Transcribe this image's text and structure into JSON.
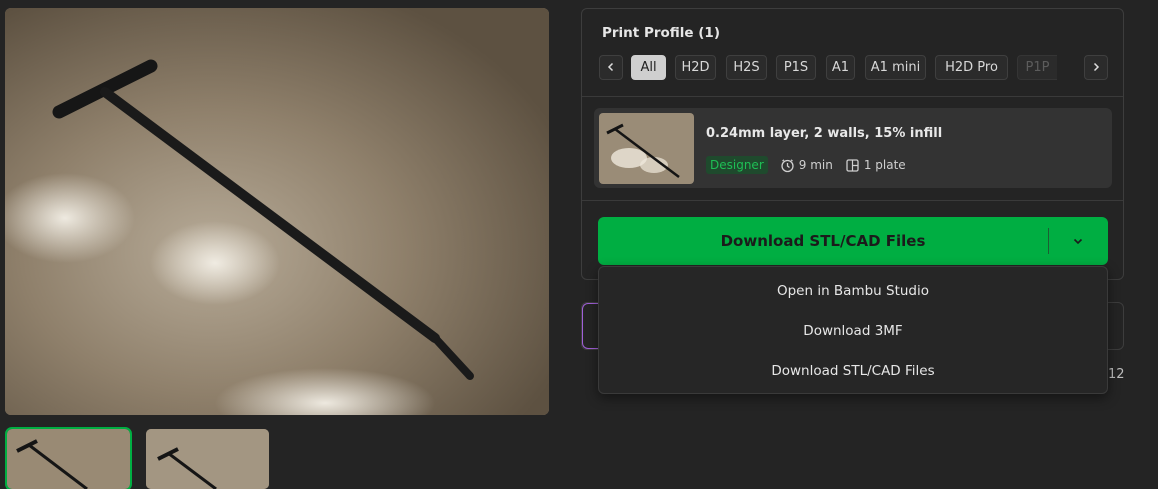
{
  "profile": {
    "title": "Print Profile (1)",
    "tabs": [
      "All",
      "H2D",
      "H2S",
      "P1S",
      "A1",
      "A1 mini",
      "H2D Pro",
      "P1P"
    ],
    "active_tab": "All",
    "card": {
      "name": "0.24mm layer, 2 walls, 15% infill",
      "badge": "Designer",
      "time": "9 min",
      "plates": "1 plate"
    }
  },
  "download": {
    "label": "Download STL/CAD Files",
    "menu": [
      "Open in Bambu Studio",
      "Download 3MF",
      "Download STL/CAD Files"
    ]
  },
  "partial_text": "12",
  "colors": {
    "accent": "#00ae42",
    "badge_text": "#1fbf55",
    "badge_bg": "#1f4a2d",
    "highlight_border": "#a060d8"
  },
  "icons": {
    "prev": "chevron-left-icon",
    "next": "chevron-right-icon",
    "time": "clock-icon",
    "plate": "plate-icon",
    "menu": "chevron-down-icon"
  }
}
